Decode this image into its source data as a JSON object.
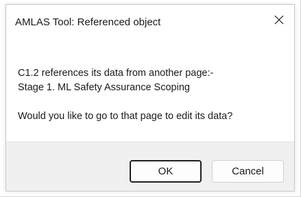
{
  "dialog": {
    "title": "AMLAS Tool: Referenced object",
    "message": {
      "line1": "C1.2 references its data from another page:-",
      "line2": "Stage 1. ML Safety Assurance Scoping",
      "line3": "Would you like to go to that page to edit its data?"
    },
    "buttons": {
      "ok_label": "OK",
      "cancel_label": "Cancel"
    },
    "close_icon": "close-icon"
  },
  "colors": {
    "footer_bg": "#f0f0f0",
    "text": "#1a1a1a",
    "default_button_border": "#1f1f1f"
  }
}
